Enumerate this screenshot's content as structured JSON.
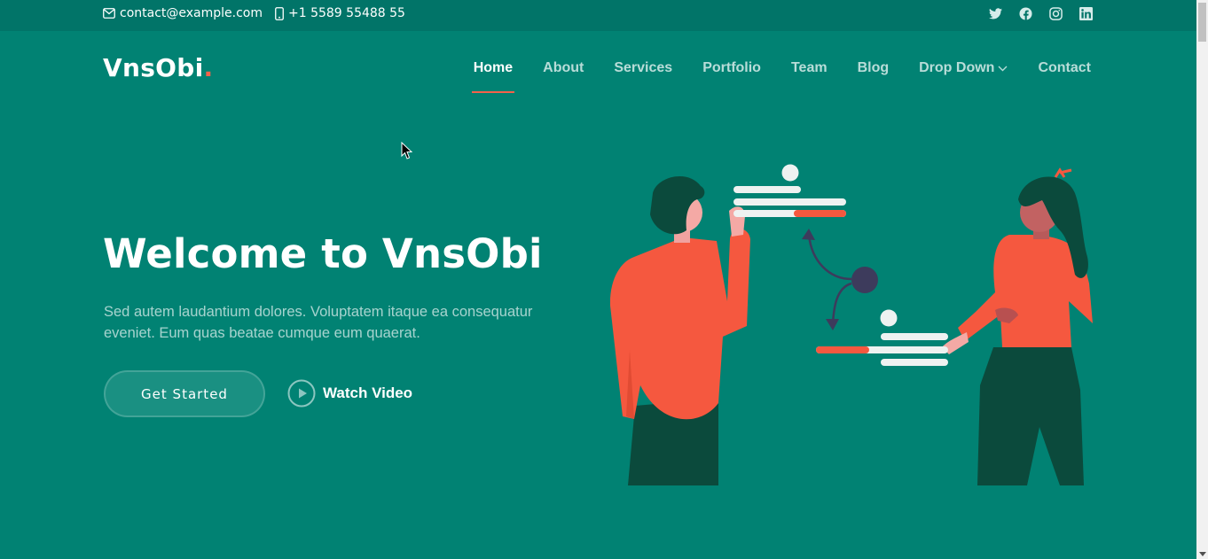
{
  "topbar": {
    "email": "contact@example.com",
    "phone": "+1 5589 55488 55",
    "email_icon": "envelope-icon",
    "phone_icon": "phone-icon",
    "socials": [
      "twitter-icon",
      "facebook-icon",
      "instagram-icon",
      "linkedin-icon"
    ]
  },
  "header": {
    "logo_text": "VnsObi",
    "logo_dot": ".",
    "nav": [
      {
        "label": "Home",
        "active": true
      },
      {
        "label": "About"
      },
      {
        "label": "Services"
      },
      {
        "label": "Portfolio"
      },
      {
        "label": "Team"
      },
      {
        "label": "Blog"
      },
      {
        "label": "Drop Down"
      },
      {
        "label": "Contact"
      }
    ]
  },
  "hero": {
    "title": "Welcome to VnsObi",
    "text": "Sed autem laudantium dolores. Voluptatem itaque ea consequatur eveniet. Eum quas beatae cumque eum quaerat.",
    "cta_primary": "Get Started",
    "cta_secondary": "Watch Video"
  },
  "colors": {
    "background": "#018273",
    "topbar": "#017468",
    "accent": "#f5624a",
    "dark_green": "#0b4a3c"
  }
}
